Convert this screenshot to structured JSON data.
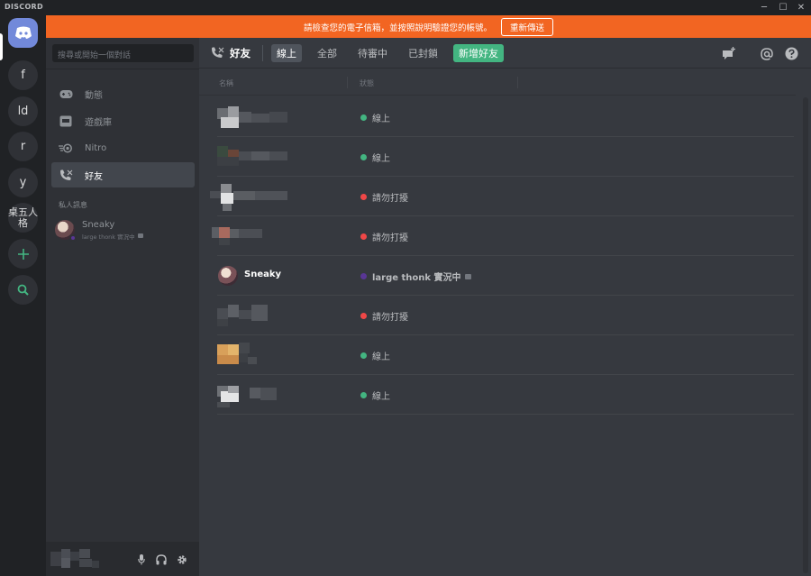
{
  "app": {
    "brand": "DISCORD",
    "window_controls": {
      "minimize": "─",
      "maximize": "☐",
      "close": "✕"
    }
  },
  "servers": [
    {
      "label": "f"
    },
    {
      "label": "ld"
    },
    {
      "label": "r"
    },
    {
      "label": "y"
    },
    {
      "label": "桌五人格"
    }
  ],
  "banner": {
    "text": "請檢查您的電子信箱，並按照說明驗證您的帳號。",
    "button": "重新傳送"
  },
  "sidebar": {
    "search_placeholder": "搜尋或開始一個對話",
    "nav": [
      {
        "label": "動態"
      },
      {
        "label": "遊戲庫"
      },
      {
        "label": "Nitro"
      },
      {
        "label": "好友"
      }
    ],
    "dm_section_title": "私人訊息",
    "dms": [
      {
        "name": "Sneaky",
        "activity": "large thonk 實況中"
      }
    ]
  },
  "header": {
    "title": "好友",
    "tabs": [
      "線上",
      "全部",
      "待審中",
      "已封鎖"
    ],
    "add_friend": "新增好友"
  },
  "columns": {
    "name": "名稱",
    "status": "狀態"
  },
  "friends": [
    {
      "name": "",
      "status": "線上",
      "status_color": "#43b581",
      "blurred": true
    },
    {
      "name": "",
      "status": "線上",
      "status_color": "#43b581",
      "blurred": true
    },
    {
      "name": "",
      "status": "請勿打擾",
      "status_color": "#f04747",
      "blurred": true
    },
    {
      "name": "",
      "status": "請勿打擾",
      "status_color": "#f04747",
      "blurred": true
    },
    {
      "name": "Sneaky",
      "status": "large thonk 實況中",
      "status_color": "#593695",
      "blurred": false
    },
    {
      "name": "",
      "status": "請勿打擾",
      "status_color": "#f04747",
      "blurred": true
    },
    {
      "name": "",
      "status": "線上",
      "status_color": "#43b581",
      "blurred": true
    },
    {
      "name": "",
      "status": "線上",
      "status_color": "#43b581",
      "blurred": true
    }
  ],
  "colors": {
    "accent": "#7289da",
    "banner": "#f26522",
    "online": "#43b581",
    "dnd": "#f04747",
    "streaming": "#593695"
  }
}
